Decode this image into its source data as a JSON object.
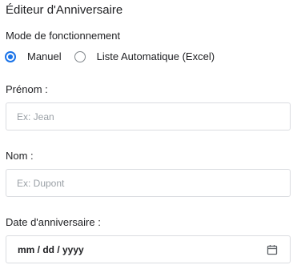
{
  "form": {
    "title": "Éditeur d'Anniversaire",
    "mode_label": "Mode de fonctionnement",
    "modes": [
      {
        "label": "Manuel",
        "selected": true
      },
      {
        "label": "Liste Automatique (Excel)",
        "selected": false
      }
    ],
    "first_name": {
      "label": "Prénom :",
      "placeholder": "Ex: Jean",
      "value": ""
    },
    "last_name": {
      "label": "Nom :",
      "placeholder": "Ex: Dupont",
      "value": ""
    },
    "birthday": {
      "label": "Date d'anniversaire :",
      "display": "mm / dd / yyyy",
      "icon": "calendar-icon"
    }
  },
  "colors": {
    "accent": "#1a73e8",
    "border": "#dadce0",
    "placeholder": "#9aa0a6",
    "text": "#202124"
  }
}
